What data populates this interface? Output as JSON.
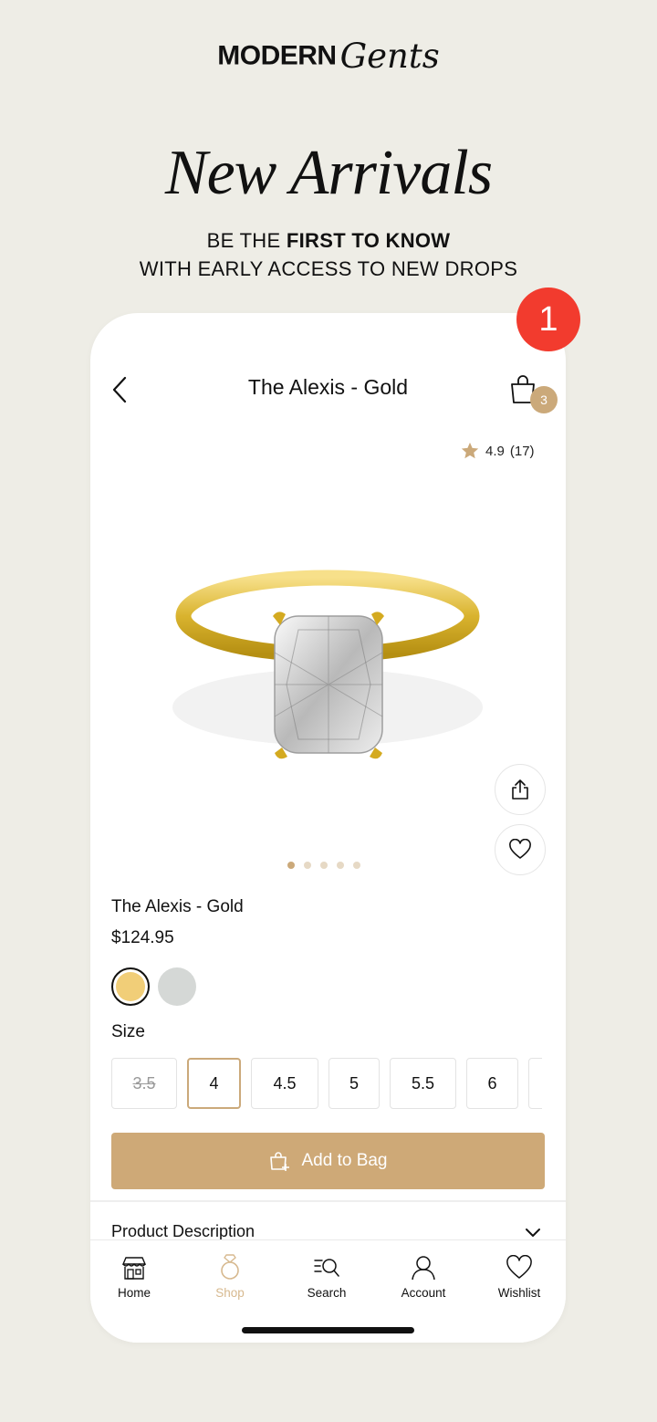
{
  "brand": {
    "word1": "MODERN",
    "word2": "Gents"
  },
  "headline": "New Arrivals",
  "subline": {
    "part1": "BE THE ",
    "bold": "FIRST TO KNOW",
    "line2": "WITH EARLY ACCESS TO NEW DROPS"
  },
  "notification_count": "1",
  "header": {
    "title": "The Alexis - Gold",
    "bag_count": "3"
  },
  "rating": {
    "value": "4.9",
    "count": "(17)"
  },
  "gallery": {
    "image_count": 5,
    "active_index": 0
  },
  "product": {
    "name": "The Alexis - Gold",
    "price": "$124.95"
  },
  "swatches": [
    {
      "name": "gold",
      "color": "#F1CE78",
      "selected": true
    },
    {
      "name": "silver",
      "color": "#D5D8D6",
      "selected": false
    }
  ],
  "size_label": "Size",
  "sizes": [
    {
      "label": "3.5",
      "state": "unavailable"
    },
    {
      "label": "4",
      "state": "selected"
    },
    {
      "label": "4.5",
      "state": "available"
    },
    {
      "label": "5",
      "state": "available"
    },
    {
      "label": "5.5",
      "state": "available"
    },
    {
      "label": "6",
      "state": "available"
    }
  ],
  "add_to_bag": "Add to Bag",
  "description_label": "Product Description",
  "tabs": [
    {
      "label": "Home",
      "icon": "store-icon",
      "active": false
    },
    {
      "label": "Shop",
      "icon": "ring-icon",
      "active": true
    },
    {
      "label": "Search",
      "icon": "search-icon",
      "active": false
    },
    {
      "label": "Account",
      "icon": "person-icon",
      "active": false
    },
    {
      "label": "Wishlist",
      "icon": "heart-icon",
      "active": false
    }
  ],
  "colors": {
    "background": "#EEEDE6",
    "accent": "#CEA977",
    "badge_red": "#F23B2E"
  }
}
